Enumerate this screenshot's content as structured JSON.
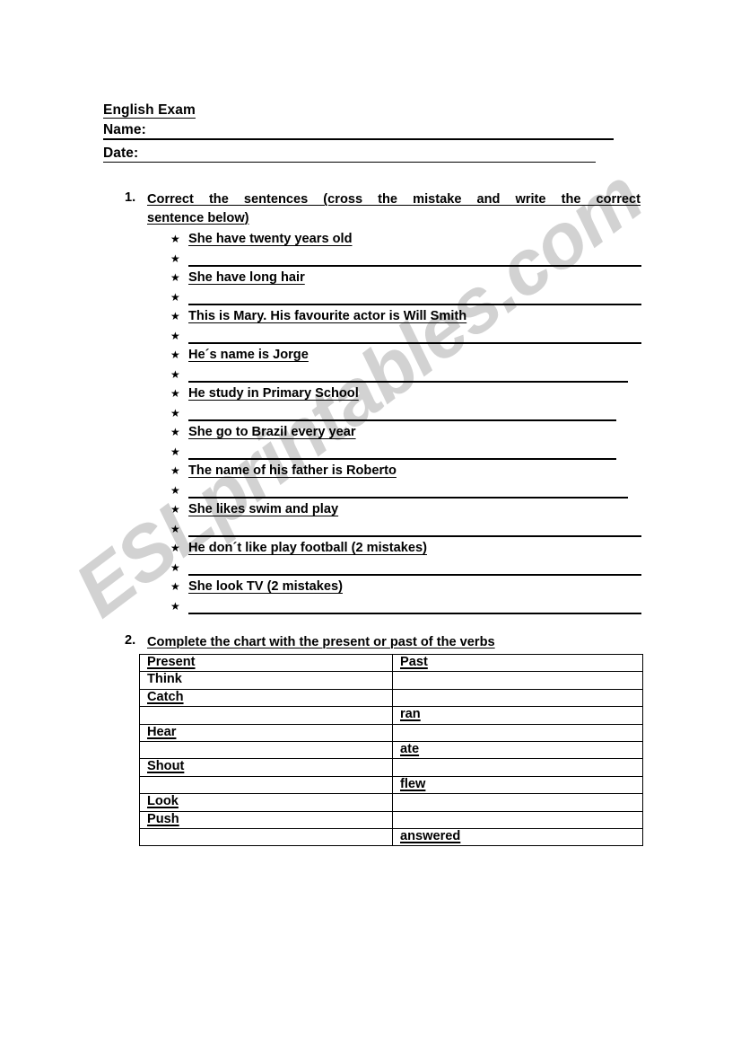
{
  "watermark": {
    "text": "ESLprintables.com",
    "color": "#d2d2d2"
  },
  "header": {
    "title": "English Exam",
    "name_label": "Name:",
    "date_label": "Date:"
  },
  "exercise1": {
    "number": "1.",
    "instruction_line1": "Correct the sentences (cross the mistake and write the correct",
    "instruction_line2": "sentence below)",
    "bullet_glyph": "★",
    "sentences": [
      "She have twenty years old",
      "She have long hair",
      "This is Mary. His favourite actor is Will Smith",
      "He´s name is Jorge",
      "He study in Primary School",
      "She go to Brazil every year",
      "The name of his father is Roberto",
      "She likes swim and play",
      "He don´t like play football (2 mistakes)",
      "She look TV (2 mistakes)"
    ],
    "blank_line_widths": [
      505,
      505,
      505,
      490,
      477,
      477,
      490,
      505,
      505,
      505
    ]
  },
  "exercise2": {
    "number": "2.",
    "instruction": "Complete the chart with the present or past of the verbs",
    "table": {
      "headers": [
        "Present",
        "Past"
      ],
      "rows": [
        {
          "present": "Think",
          "past": "",
          "present_underlined": false
        },
        {
          "present": "Catch",
          "past": "",
          "present_underlined": true
        },
        {
          "present": "",
          "past": "ran",
          "present_underlined": false
        },
        {
          "present": "Hear",
          "past": "",
          "present_underlined": true
        },
        {
          "present": "",
          "past": "ate",
          "present_underlined": false
        },
        {
          "present": "Shout",
          "past": "",
          "present_underlined": true
        },
        {
          "present": "",
          "past": "flew",
          "present_underlined": false
        },
        {
          "present": "Look",
          "past": "",
          "present_underlined": true
        },
        {
          "present": "Push",
          "past": "",
          "present_underlined": true
        },
        {
          "present": "",
          "past": "answered",
          "present_underlined": false
        }
      ]
    }
  }
}
